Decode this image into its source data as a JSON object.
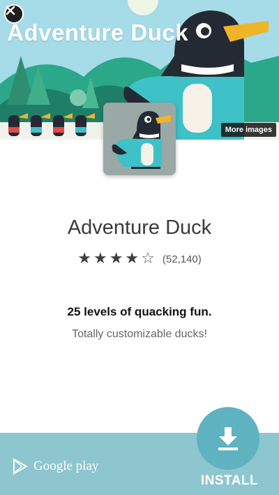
{
  "banner": {
    "title": "Adventure Duck",
    "more_images_label": "More images",
    "sky_color": "#a6dbe8"
  },
  "app": {
    "name": "Adventure Duck",
    "rating": 4,
    "rating_max": 5,
    "rating_count": "(52,140)",
    "headline": "25 levels of quacking fun.",
    "subline": "Totally customizable ducks!"
  },
  "footer": {
    "store_name": "Google play",
    "install_label": "INSTALL",
    "accent_color": "#5fb2c0"
  },
  "icons": {
    "close": "close-icon",
    "play": "google-play-icon",
    "download": "download-icon"
  }
}
